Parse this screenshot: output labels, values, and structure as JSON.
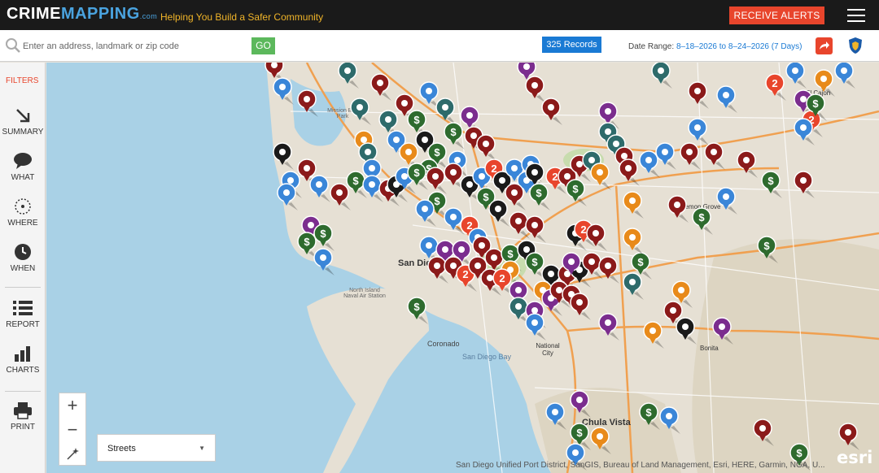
{
  "header": {
    "logo_crime": "CRIME",
    "logo_mapping": "MAPPING",
    "logo_com": ".com",
    "tagline": "Helping You Build a Safer Community",
    "alerts_label": "RECEIVE ALERTS",
    "menu_icon": "hamburger-icon"
  },
  "search": {
    "placeholder": "Enter an address, landmark or zip code",
    "value": "",
    "go_label": "GO",
    "records_label": "325 Records",
    "date_range_label": "Date Range:",
    "date_range_value": "8–18–2026 to 8–24–2026 (7 Days)"
  },
  "sidebar": {
    "filters_label": "FILTERS",
    "items": [
      {
        "label": "SUMMARY",
        "icon": "arrow-down-right-icon"
      },
      {
        "label": "WHAT",
        "icon": "speech-bubble-icon"
      },
      {
        "label": "WHERE",
        "icon": "target-icon"
      },
      {
        "label": "WHEN",
        "icon": "clock-icon"
      },
      {
        "label": "REPORT",
        "icon": "list-icon"
      },
      {
        "label": "CHARTS",
        "icon": "bar-chart-icon"
      },
      {
        "label": "PRINT",
        "icon": "printer-icon"
      }
    ]
  },
  "map": {
    "place_labels": [
      "San Diego",
      "North Island Naval Air Station",
      "Coronado",
      "San Diego Bay",
      "National City",
      "Bonita",
      "Chula Vista",
      "Mission Bay Park",
      "Lemon Grove",
      "El Cajon"
    ],
    "basemap": "Streets",
    "attribution": "San Diego Unified Port District, SanGIS, Bureau of Land Management, Esri, HERE, Garmin, NGA, U...",
    "esri_label": "esri",
    "colors": {
      "assault": "#8b1a1a",
      "theft_money": "#2e6b2e",
      "vehicle": "#7b2d8e",
      "burglary": "#1a1a1a",
      "dui": "#3a86d8",
      "vandalism": "#e88a1a",
      "arrest": "#2e6b6b",
      "cluster": "#e8452c"
    }
  }
}
